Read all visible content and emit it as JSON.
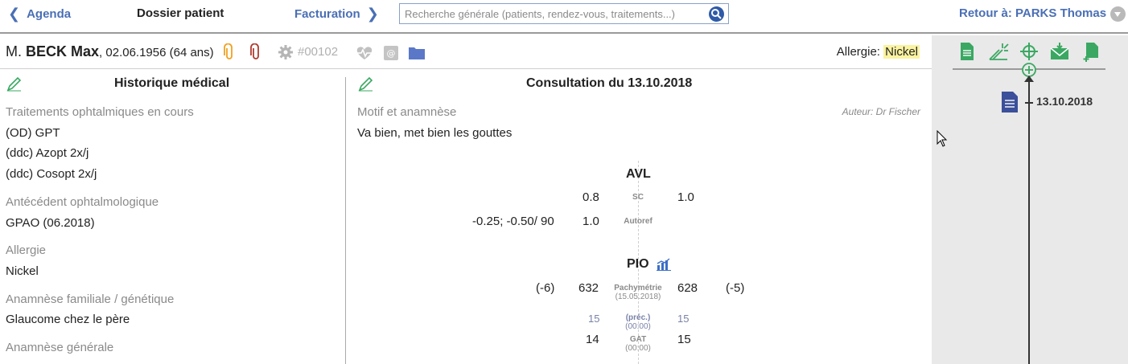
{
  "nav": {
    "back_label": "Agenda",
    "title": "Dossier patient",
    "forward_label": "Facturation",
    "search_placeholder": "Recherche générale (patients, rendez-vous, traitements...)",
    "retour_label": "Retour à: PARKS Thomas"
  },
  "patient": {
    "salutation": "M.",
    "name": "BECK Max",
    "dob": ", 02.06.1956 (64 ans)",
    "id": "#00102",
    "allergy_label": "Allergie:",
    "allergy_value": "Nickel"
  },
  "history": {
    "title": "Historique médical",
    "sections": [
      {
        "label": "Traitements ophtalmiques en cours",
        "values": [
          "(OD) GPT",
          "(ddc) Azopt 2x/j",
          "(ddc) Cosopt 2x/j"
        ]
      },
      {
        "label": "Antécédent ophtalmologique",
        "values": [
          "GPAO (06.2018)"
        ]
      },
      {
        "label": "Allergie",
        "values": [
          "Nickel"
        ]
      },
      {
        "label": "Anamnèse familiale / génétique",
        "values": [
          "Glaucome chez le père"
        ]
      },
      {
        "label": "Anamnèse générale",
        "values": []
      }
    ]
  },
  "consultation": {
    "title": "Consultation du 13.10.2018",
    "motif_label": "Motif et anamnèse",
    "author": "Auteur: Dr Fischer",
    "motif_text": "Va bien, met bien les gouttes",
    "avl": {
      "title": "AVL",
      "sc": {
        "label": "SC",
        "right": "0.8",
        "left": "1.0"
      },
      "autoref": {
        "label": "Autoref",
        "right_refraction": "-0.25; -0.50/ 90",
        "right": "1.0"
      }
    },
    "pio": {
      "title": "PIO",
      "pachy": {
        "label": "Pachymétrie",
        "date": "(15.05.2018)",
        "right_corr": "(-6)",
        "right": "632",
        "left": "628",
        "left_corr": "(-5)"
      },
      "prec": {
        "label": "(préc.)",
        "time": "(00:00)",
        "right": "15",
        "left": "15"
      },
      "gat": {
        "label": "GAT",
        "time": "(00:00)",
        "right": "14",
        "left": "15"
      }
    }
  },
  "timeline": {
    "date": "13.10.2018"
  },
  "colors": {
    "link_blue": "#4a6fb5",
    "green_icon": "#3aa862",
    "doc_blue": "#3b4f9a",
    "allergy_highlight": "#faf3a0"
  }
}
